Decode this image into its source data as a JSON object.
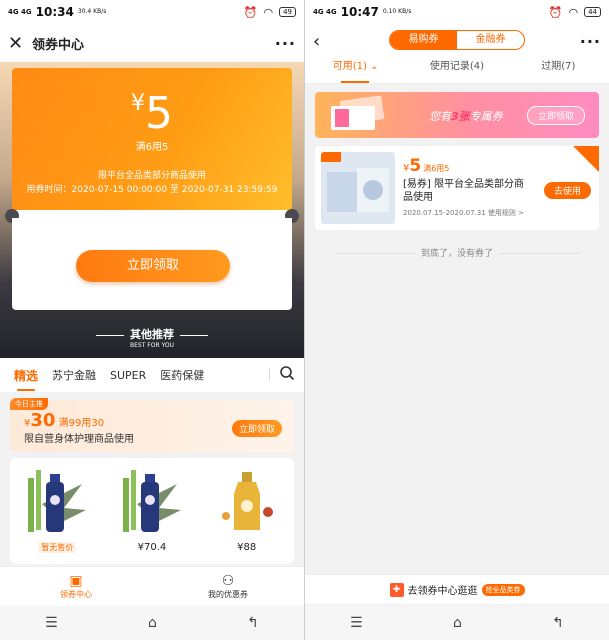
{
  "left": {
    "status": {
      "signal": "4G 4G",
      "time": "10:34",
      "speed": "30.4 KB/s",
      "battery": "49"
    },
    "header": {
      "title": "领券中心"
    },
    "coupon": {
      "currency": "¥",
      "amount": "5",
      "condition": "满6用5",
      "scope": "限平台全品类部分商品使用",
      "period": "用券时间：2020-07-15 00:00:00 至 2020-07-31 23:59:59",
      "claim_label": "立即领取"
    },
    "recommend": {
      "title": "其他推荐",
      "subtitle": "BEST FOR YOU"
    },
    "tabs": [
      "精选",
      "苏宁金融",
      "SUPER",
      "医药保健"
    ],
    "promo": {
      "badge": "今日主推",
      "currency": "¥",
      "amount": "30",
      "condition": "满99用30",
      "desc": "限自营身体护理商品使用",
      "button": "立即领取"
    },
    "products": [
      {
        "price": "暂无售价"
      },
      {
        "price": "¥70.4"
      },
      {
        "price": "¥88"
      }
    ],
    "bottom_nav": [
      {
        "label": "领券中心",
        "icon": "coupon-icon"
      },
      {
        "label": "我的优惠券",
        "icon": "user-icon"
      }
    ]
  },
  "right": {
    "status": {
      "signal": "4G 4G",
      "time": "10:47",
      "speed": "0.10 KB/s",
      "battery": "44"
    },
    "segments": [
      "易购券",
      "金融券"
    ],
    "subtabs": [
      "可用(1)",
      "使用记录(4)",
      "过期(7)"
    ],
    "banner": {
      "ticket_text": "优惠券",
      "text_before": "您有",
      "count": "3张",
      "text_after": "专属券",
      "button": "立即领取"
    },
    "coupon": {
      "image_tag": "拼购",
      "image_text": "防霉防蛀",
      "new_tag": "新到",
      "currency": "¥",
      "amount": "5",
      "condition": "满6用5",
      "name": "[易券] 限平台全品类部分商品使用",
      "date": "2020.07.15-2020.07.31 使用规则 >",
      "use_label": "去使用"
    },
    "end_text": "到底了，没有券了",
    "footer": {
      "label": "去领券中心逛逛",
      "tag": "抢全品类券"
    }
  },
  "colors": {
    "accent": "#ff6a00"
  }
}
